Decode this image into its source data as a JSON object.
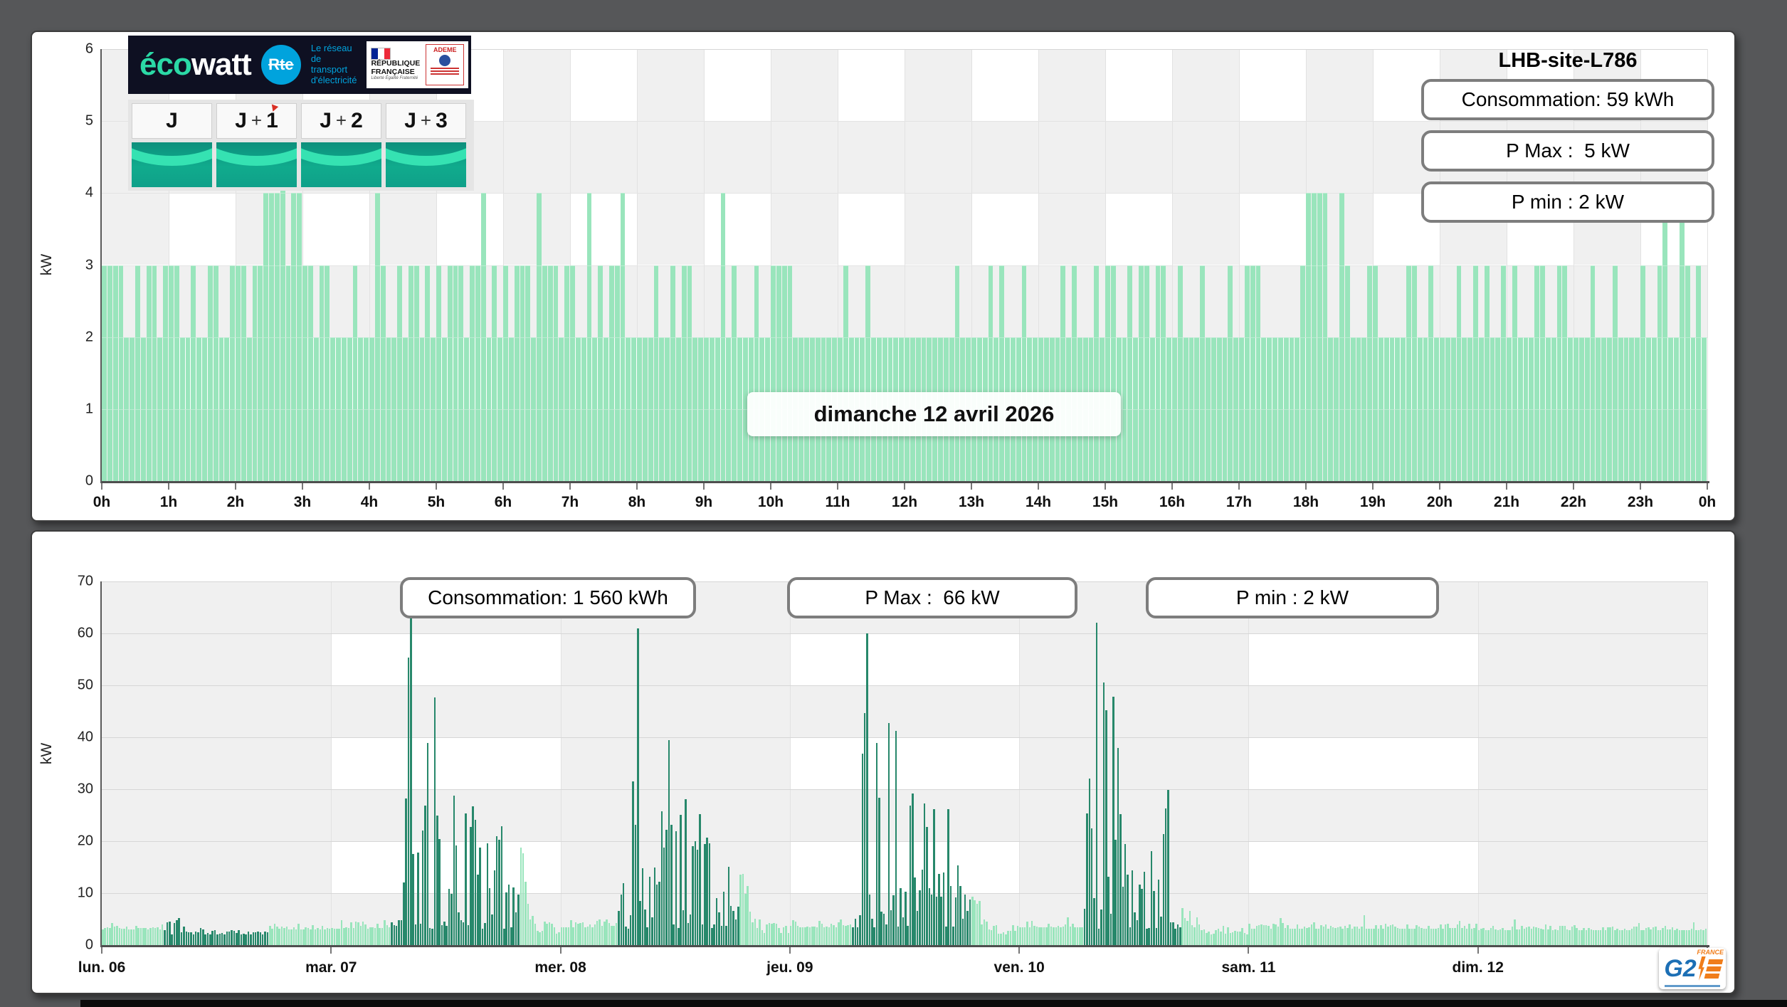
{
  "site": {
    "name": "LHB-site-L786"
  },
  "branding": {
    "ecowatt": {
      "eco": "éco",
      "watt": "watt",
      "eco_color": "#2bd9a6",
      "bg": "#0e1022"
    },
    "rte": {
      "abbr": "Rte",
      "tagline_lines": [
        "Le réseau",
        "de transport",
        "d'électricité"
      ],
      "color": "#00a3dd"
    },
    "republique": {
      "line1": "RÉPUBLIQUE",
      "line2": "FRANÇAISE",
      "motto": "Liberté Égalité Fraternité"
    },
    "ademe": {
      "name": "ADEME"
    },
    "g2e": {
      "g2": "G2",
      "country": "FRANCE"
    }
  },
  "forecast_tiles": [
    {
      "parts": [
        "J"
      ],
      "marker": false
    },
    {
      "parts": [
        "J",
        "+",
        "1"
      ],
      "marker": true
    },
    {
      "parts": [
        "J",
        "+",
        "2"
      ],
      "marker": false
    },
    {
      "parts": [
        "J",
        "+",
        "3"
      ],
      "marker": false
    }
  ],
  "top_chart": {
    "stats": [
      "Consommation: 59 kWh",
      "P Max :  5 kW",
      "P min : 2 kW"
    ],
    "date_label": "dimanche 12 avril 2026",
    "ylabel": "kW",
    "yticks": [
      0,
      1,
      2,
      3,
      4,
      5,
      6
    ],
    "xtick_labels": [
      "0h",
      "1h",
      "2h",
      "3h",
      "4h",
      "5h",
      "6h",
      "7h",
      "8h",
      "9h",
      "10h",
      "11h",
      "12h",
      "13h",
      "14h",
      "15h",
      "16h",
      "17h",
      "18h",
      "19h",
      "20h",
      "21h",
      "22h",
      "23h",
      "0h"
    ]
  },
  "bottom_chart": {
    "stats": [
      "Consommation: 1 560 kWh",
      "P Max :  66 kW",
      "P min : 2 kW"
    ],
    "ylabel": "kW",
    "yticks": [
      0,
      10,
      20,
      30,
      40,
      50,
      60,
      70
    ],
    "xtick_labels": [
      "lun. 06",
      "mar. 07",
      "mer. 08",
      "jeu. 09",
      "ven. 10",
      "sam. 11",
      "dim. 12"
    ]
  },
  "chart_data": [
    {
      "type": "bar",
      "title": "dimanche 12 avril 2026",
      "ylabel": "kW",
      "ylim": [
        0,
        6
      ],
      "x_axis": {
        "unit": "hours",
        "range": [
          0,
          24
        ]
      },
      "resolution_minutes": 5,
      "baseline_kw": 2,
      "spikes_3kw_density": [
        [
          0,
          9.5,
          0.45
        ],
        [
          9.5,
          17,
          0.22
        ],
        [
          17,
          24,
          0.42
        ]
      ],
      "spikes_4kw_at_hours": [
        2.4,
        2.45,
        2.5,
        2.6,
        2.85,
        2.95,
        4.05,
        5.7,
        6.5,
        7.25,
        7.75,
        9.25,
        18.0,
        18.08,
        18.17,
        18.25,
        18.5,
        23.3,
        23.6
      ],
      "spikes_5kw_at_hours": [
        2.7
      ],
      "bar_color": "#99e5bc",
      "stats": {
        "consumption_kwh": 59,
        "p_max_kw": 5,
        "p_min_kw": 2
      },
      "background": "checker: white cell when hour odd and 1kW-band odd, else #f0f0f0"
    },
    {
      "type": "bar",
      "ylabel": "kW",
      "ylim": [
        0,
        70
      ],
      "x_axis": {
        "unit": "days",
        "tick_labels": [
          "lun. 06",
          "mar. 07",
          "mer. 08",
          "jeu. 09",
          "ven. 10",
          "sam. 11",
          "dim. 12"
        ]
      },
      "resolution_minutes": 15,
      "colors": {
        "light": "#99e5bc",
        "dark": "#27886b"
      },
      "stats": {
        "consumption_kwh": 1560,
        "p_max_kw": 66,
        "p_min_kw": 2
      },
      "background": "checker: white cell when day odd and 10kW-band odd, else #f0f0f0",
      "days": [
        {
          "label": "lun. 06",
          "base_kw": 3.0,
          "noise_kw": 1.2,
          "cluster": {
            "start_h": 6.3,
            "end_h": 17.3,
            "floor_kw": 2.0,
            "envelope": [
              [
                6.3,
                4.4
              ],
              [
                7.2,
                5.0
              ],
              [
                8.0,
                5.2
              ],
              [
                8.8,
                4.4
              ],
              [
                9.6,
                3.8
              ],
              [
                10.5,
                3.2
              ],
              [
                12,
                3.0
              ],
              [
                14,
                2.9
              ],
              [
                17.3,
                2.6
              ]
            ]
          }
        },
        {
          "label": "mar. 07",
          "base_kw": 3.2,
          "noise_kw": 1.4,
          "light_spikes": [
            [
              0.9,
              4.8
            ]
          ],
          "cluster": {
            "start_h": 6.2,
            "end_h": 19.5,
            "floor_kw": 3.2,
            "envelope": [
              [
                6.2,
                8
              ],
              [
                6.8,
                22
              ],
              [
                7.3,
                46
              ],
              [
                7.8,
                52
              ],
              [
                8.2,
                63
              ],
              [
                8.6,
                44
              ],
              [
                9.0,
                38
              ],
              [
                9.5,
                47
              ],
              [
                10.0,
                40
              ],
              [
                10.5,
                52
              ],
              [
                11.0,
                47
              ],
              [
                11.5,
                30
              ],
              [
                12.0,
                26
              ],
              [
                12.6,
                31
              ],
              [
                13.0,
                40
              ],
              [
                13.5,
                37
              ],
              [
                14.0,
                30
              ],
              [
                14.6,
                26
              ],
              [
                15.0,
                31
              ],
              [
                15.6,
                28
              ],
              [
                16.0,
                26
              ],
              [
                16.4,
                40
              ],
              [
                16.9,
                31
              ],
              [
                17.4,
                21
              ],
              [
                17.9,
                26
              ],
              [
                18.3,
                40
              ],
              [
                18.7,
                28
              ],
              [
                19.1,
                16
              ],
              [
                19.5,
                10
              ]
            ]
          },
          "tail": {
            "envelope": [
              [
                19.5,
                41
              ],
              [
                19.75,
                33
              ],
              [
                20.0,
                21
              ],
              [
                20.4,
                12
              ],
              [
                20.9,
                7
              ],
              [
                21.6,
                5
              ],
              [
                24,
                4
              ]
            ]
          }
        },
        {
          "label": "mer. 08",
          "base_kw": 3.4,
          "noise_kw": 1.6,
          "cluster": {
            "start_h": 6.0,
            "end_h": 18.6,
            "floor_kw": 3.2,
            "envelope": [
              [
                6.0,
                7
              ],
              [
                6.6,
                16
              ],
              [
                7.1,
                36
              ],
              [
                7.6,
                46
              ],
              [
                8.0,
                61
              ],
              [
                8.5,
                42
              ],
              [
                9.0,
                50
              ],
              [
                9.5,
                56
              ],
              [
                10.0,
                45
              ],
              [
                10.5,
                53
              ],
              [
                11.0,
                48
              ],
              [
                11.5,
                36
              ],
              [
                12.0,
                29
              ],
              [
                12.6,
                25
              ],
              [
                13.1,
                31
              ],
              [
                13.6,
                27
              ],
              [
                14.1,
                21
              ],
              [
                14.6,
                29
              ],
              [
                15.1,
                23
              ],
              [
                15.6,
                19
              ],
              [
                16.1,
                26
              ],
              [
                16.6,
                31
              ],
              [
                17.1,
                23
              ],
              [
                17.6,
                16
              ],
              [
                18.1,
                11
              ],
              [
                18.6,
                9
              ]
            ]
          },
          "tail": {
            "envelope": [
              [
                18.6,
                28
              ],
              [
                19.0,
                26
              ],
              [
                19.5,
                13
              ],
              [
                20.1,
                7
              ],
              [
                21,
                4.5
              ],
              [
                24,
                4
              ]
            ]
          }
        },
        {
          "label": "jeu. 09",
          "base_kw": 3.4,
          "noise_kw": 1.5,
          "cluster": {
            "start_h": 6.5,
            "end_h": 18.8,
            "floor_kw": 3.4,
            "envelope": [
              [
                6.5,
                9
              ],
              [
                7.0,
                21
              ],
              [
                7.5,
                41
              ],
              [
                8.0,
                60
              ],
              [
                8.4,
                57
              ],
              [
                8.9,
                46
              ],
              [
                9.4,
                59
              ],
              [
                9.9,
                51
              ],
              [
                10.4,
                55
              ],
              [
                10.9,
                46
              ],
              [
                11.4,
                39
              ],
              [
                11.9,
                43
              ],
              [
                12.4,
                36
              ],
              [
                12.9,
                31
              ],
              [
                13.4,
                36
              ],
              [
                13.9,
                31
              ],
              [
                14.4,
                26
              ],
              [
                14.9,
                31
              ],
              [
                15.4,
                26
              ],
              [
                15.9,
                21
              ],
              [
                16.4,
                29
              ],
              [
                16.9,
                23
              ],
              [
                17.4,
                16
              ],
              [
                17.9,
                19
              ],
              [
                18.4,
                13
              ],
              [
                18.8,
                9
              ]
            ]
          },
          "tail": {
            "envelope": [
              [
                18.8,
                18
              ],
              [
                19.2,
                15
              ],
              [
                19.7,
                9
              ],
              [
                20.3,
                5.5
              ],
              [
                21,
                4.5
              ],
              [
                24,
                4
              ]
            ]
          }
        },
        {
          "label": "ven. 10",
          "base_kw": 3.4,
          "noise_kw": 1.5,
          "cluster": {
            "start_h": 6.6,
            "end_h": 16.9,
            "floor_kw": 3.2,
            "envelope": [
              [
                6.6,
                11
              ],
              [
                7.0,
                26
              ],
              [
                7.5,
                46
              ],
              [
                8.0,
                62
              ],
              [
                8.4,
                51
              ],
              [
                8.8,
                56
              ],
              [
                9.2,
                49
              ],
              [
                9.6,
                58
              ],
              [
                10.0,
                46
              ],
              [
                10.4,
                36
              ],
              [
                10.8,
                31
              ],
              [
                11.2,
                26
              ],
              [
                11.6,
                21
              ],
              [
                12.0,
                19
              ],
              [
                12.5,
                16
              ],
              [
                13.0,
                21
              ],
              [
                13.5,
                26
              ],
              [
                14.0,
                31
              ],
              [
                14.5,
                29
              ],
              [
                15.0,
                23
              ],
              [
                15.5,
                31
              ],
              [
                16.0,
                26
              ],
              [
                16.5,
                13
              ],
              [
                16.9,
                9
              ]
            ]
          },
          "tail": {
            "envelope": [
              [
                16.9,
                7.5
              ],
              [
                18.0,
                6.5
              ],
              [
                19.0,
                5.5
              ],
              [
                20,
                4
              ],
              [
                24,
                3.5
              ]
            ]
          }
        },
        {
          "label": "sam. 11",
          "base_kw": 3.1,
          "noise_kw": 1.1,
          "light_spikes": [
            [
              3.2,
              5.2
            ],
            [
              12.1,
              5.8
            ]
          ]
        },
        {
          "label": "dim. 12",
          "base_kw": 2.9,
          "noise_kw": 1.0,
          "light_spikes": [
            [
              3.7,
              5.0
            ],
            [
              22.5,
              4.4
            ]
          ]
        }
      ]
    }
  ]
}
